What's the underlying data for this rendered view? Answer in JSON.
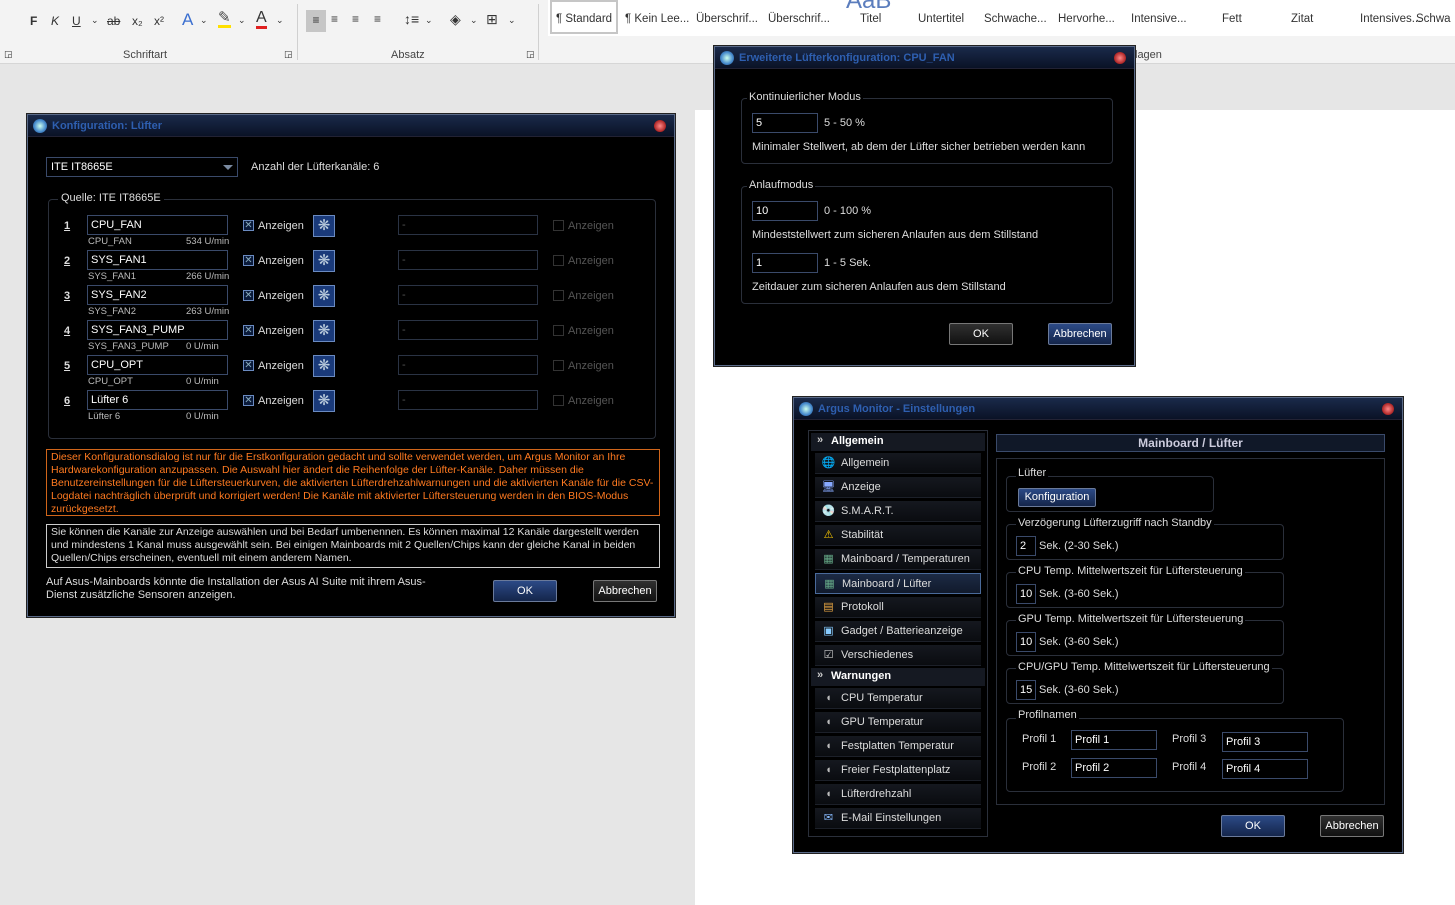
{
  "ribbon": {
    "format_buttons": [
      "F",
      "K",
      "U",
      "ab",
      "x₂",
      "x²"
    ],
    "groups": {
      "font": "Schriftart",
      "paragraph": "Absatz",
      "styles_tail": "lagen"
    },
    "styles": [
      {
        "label": "¶ Standard",
        "selected": true
      },
      {
        "label": "¶ Kein Lee..."
      },
      {
        "label": "Überschrif..."
      },
      {
        "label": "Überschrif..."
      },
      {
        "label": "Titel",
        "preview": "AaB"
      },
      {
        "label": "Untertitel"
      },
      {
        "label": "Schwache..."
      },
      {
        "label": "Hervorhe..."
      },
      {
        "label": "Intensive..."
      },
      {
        "label": "Fett"
      },
      {
        "label": "Zitat"
      },
      {
        "label": "Intensives..."
      },
      {
        "label": "Schwa"
      }
    ]
  },
  "fan_dialog": {
    "title": "Konfiguration: Lüfter",
    "chip_select": "ITE IT8665E",
    "channel_count": "Anzahl der Lüfterkanäle: 6",
    "source_label": "Quelle: ITE IT8665E",
    "rows": [
      {
        "num": "1",
        "name": "CPU_FAN",
        "sensor": "CPU_FAN",
        "rpm": "534 U/min",
        "show": "Anzeigen",
        "alt": "-",
        "alt_show": "Anzeigen"
      },
      {
        "num": "2",
        "name": "SYS_FAN1",
        "sensor": "SYS_FAN1",
        "rpm": "266 U/min",
        "show": "Anzeigen",
        "alt": "-",
        "alt_show": "Anzeigen"
      },
      {
        "num": "3",
        "name": "SYS_FAN2",
        "sensor": "SYS_FAN2",
        "rpm": "263 U/min",
        "show": "Anzeigen",
        "alt": "-",
        "alt_show": "Anzeigen"
      },
      {
        "num": "4",
        "name": "SYS_FAN3_PUMP",
        "sensor": "SYS_FAN3_PUMP",
        "rpm": "0 U/min",
        "show": "Anzeigen",
        "alt": "-",
        "alt_show": "Anzeigen"
      },
      {
        "num": "5",
        "name": "CPU_OPT",
        "sensor": "CPU_OPT",
        "rpm": "0 U/min",
        "show": "Anzeigen",
        "alt": "-",
        "alt_show": "Anzeigen"
      },
      {
        "num": "6",
        "name": "Lüfter 6",
        "sensor": "Lüfter 6",
        "rpm": "0 U/min",
        "show": "Anzeigen",
        "alt": "-",
        "alt_show": "Anzeigen"
      }
    ],
    "warning": "Dieser Konfigurationsdialog ist nur für die Erstkonfiguration gedacht und sollte verwendet werden, um Argus Monitor an Ihre Hardwarekonfiguration anzupassen. Die Auswahl hier ändert die Reihenfolge der Lüfter-Kanäle. Daher müssen die Benutzereinstellungen für die Lüftersteuerkurven, die aktivierten Lüfterdrehzahlwarnungen und die aktivierten Kanäle für die CSV-Logdatei nachträglich überprüft und korrigiert werden! Die Kanäle mit aktivierter Lüftersteuerung werden in den BIOS-Modus zurückgesetzt.",
    "info": "Sie können die Kanäle zur Anzeige auswählen und bei Bedarf umbenennen. Es können maximal 12 Kanäle dargestellt werden und mindestens 1 Kanal muss ausgewählt sein. Bei einigen Mainboards mit 2 Quellen/Chips kann der gleiche Kanal in beiden Quellen/Chips erscheinen, eventuell mit einem anderem Namen.",
    "asus_note": "Auf Asus-Mainboards könnte die Installation der Asus AI Suite mit ihrem Asus-Dienst zusätzliche Sensoren anzeigen.",
    "ok": "OK",
    "cancel": "Abbrechen"
  },
  "ext_dialog": {
    "title": "Erweiterte Lüfterkonfiguration: CPU_FAN",
    "continuous_label": "Kontinuierlicher Modus",
    "min_value": "5",
    "min_range": "5 - 50 %",
    "min_desc": "Minimaler Stellwert, ab dem der Lüfter sicher betrieben werden kann",
    "startup_label": "Anlaufmodus",
    "start_value": "10",
    "start_range": "0 - 100 %",
    "start_desc": "Mindeststellwert zum sicheren Anlaufen aus dem Stillstand",
    "dur_value": "1",
    "dur_range": "1 - 5 Sek.",
    "dur_desc": "Zeitdauer zum sicheren Anlaufen aus dem Stillstand",
    "ok": "OK",
    "cancel": "Abbrechen"
  },
  "settings": {
    "title": "Argus Monitor - Einstellungen",
    "nav_general": "Allgemein",
    "nav_items": [
      {
        "label": "Allgemein",
        "icon": "globe-icon"
      },
      {
        "label": "Anzeige",
        "icon": "monitor-icon"
      },
      {
        "label": "S.M.A.R.T.",
        "icon": "disk-icon"
      },
      {
        "label": "Stabilität",
        "icon": "warning-icon"
      },
      {
        "label": "Mainboard / Temperaturen",
        "icon": "board-icon"
      },
      {
        "label": "Mainboard / Lüfter",
        "icon": "board-icon",
        "selected": true
      },
      {
        "label": "Protokoll",
        "icon": "log-icon"
      },
      {
        "label": "Gadget / Batterieanzeige",
        "icon": "gadget-icon"
      },
      {
        "label": "Verschiedenes",
        "icon": "misc-icon"
      }
    ],
    "nav_warnings": "Warnungen",
    "warn_items": [
      {
        "label": "CPU Temperatur"
      },
      {
        "label": "GPU Temperatur"
      },
      {
        "label": "Festplatten Temperatur"
      },
      {
        "label": "Freier Festplattenplatz"
      },
      {
        "label": "Lüfterdrehzahl"
      },
      {
        "label": "E-Mail Einstellungen",
        "icon": "email-icon"
      }
    ],
    "panel_title": "Mainboard / Lüfter",
    "fan_group": "Lüfter",
    "config_button": "Konfiguration",
    "delay_label": "Verzögerung Lüfterzugriff nach Standby",
    "delay_value": "2",
    "delay_unit": "Sek. (2-30 Sek.)",
    "cpu_avg_label": "CPU Temp. Mittelwertszeit für Lüftersteuerung",
    "cpu_avg_value": "10",
    "cpu_avg_unit": "Sek. (3-60 Sek.)",
    "gpu_avg_label": "GPU Temp. Mittelwertszeit für Lüftersteuerung",
    "gpu_avg_value": "10",
    "gpu_avg_unit": "Sek. (3-60 Sek.)",
    "cpugpu_avg_label": "CPU/GPU Temp. Mittelwertszeit für Lüftersteuerung",
    "cpugpu_avg_value": "15",
    "cpugpu_avg_unit": "Sek. (3-60 Sek.)",
    "profiles_label": "Profilnamen",
    "profiles": [
      {
        "label": "Profil 1",
        "value": "Profil 1"
      },
      {
        "label": "Profil 2",
        "value": "Profil 2"
      },
      {
        "label": "Profil 3",
        "value": "Profil 3"
      },
      {
        "label": "Profil 4",
        "value": "Profil 4"
      }
    ],
    "ok": "OK",
    "cancel": "Abbrechen"
  }
}
